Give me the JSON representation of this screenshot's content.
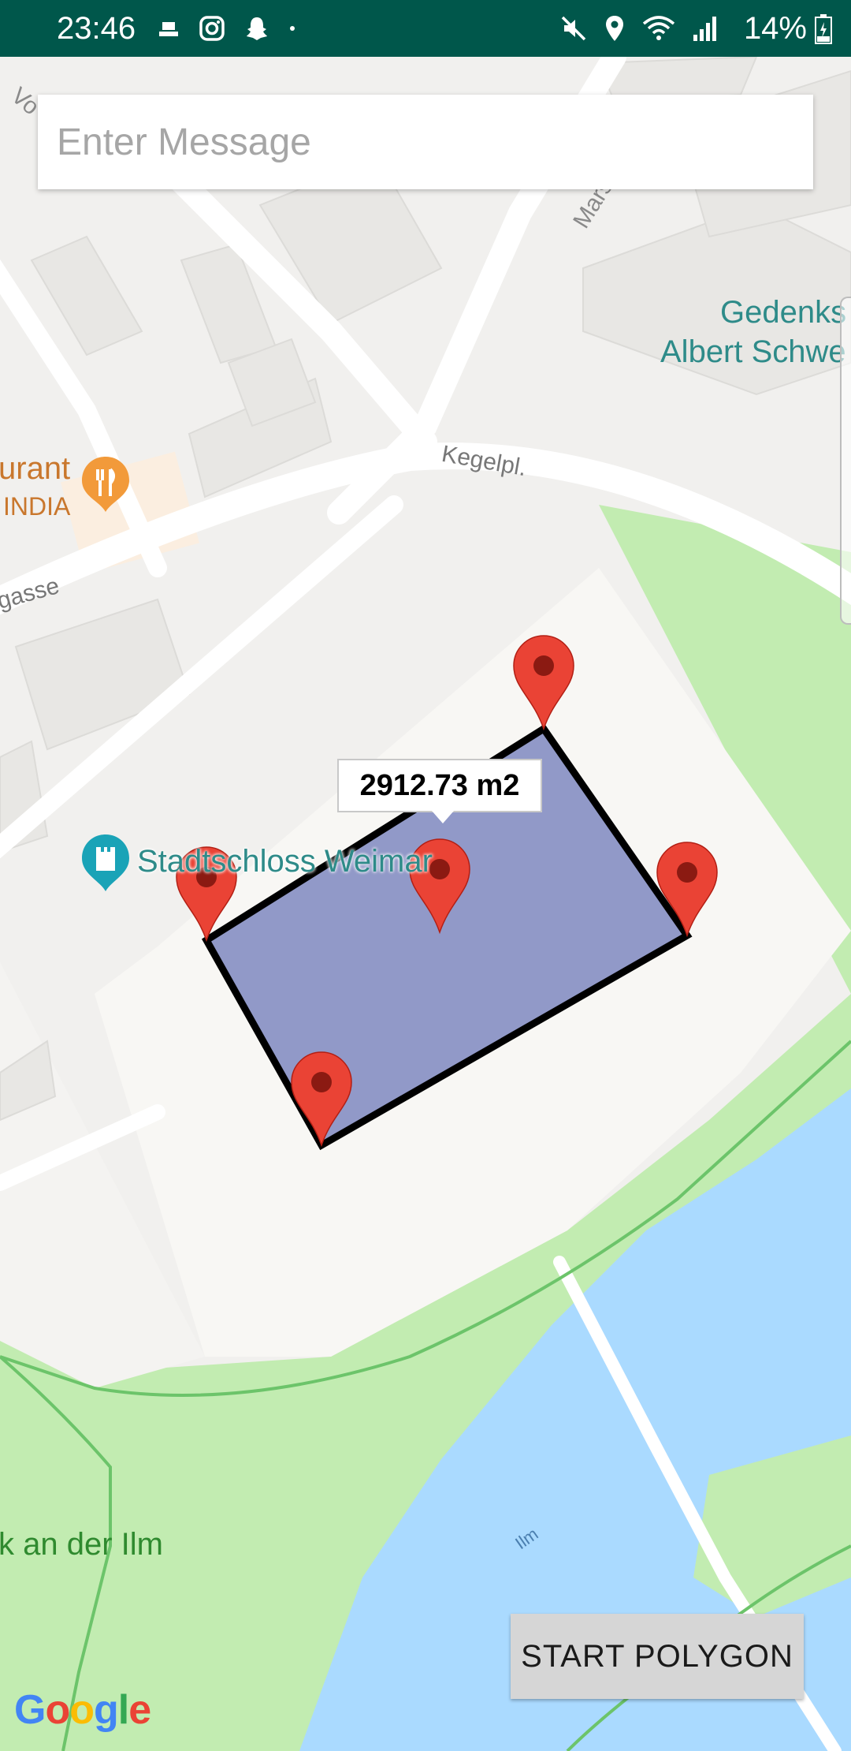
{
  "status_bar": {
    "time": "23:46",
    "battery": "14%",
    "left_icons": [
      "ship-icon",
      "instagram-icon",
      "snapchat-icon",
      "dot-icon"
    ],
    "right_icons": [
      "mute-icon",
      "location-icon",
      "wifi-icon",
      "signal-icon"
    ]
  },
  "search": {
    "placeholder": "Enter Message",
    "value": ""
  },
  "map_labels": {
    "road_top": "Marst",
    "gedenk_line1": "Gedenks",
    "gedenk_line2": "Albert Schwe",
    "restaurant_line1": "urant",
    "restaurant_line2": "INDIA",
    "kegelpl": "Kegelpl.",
    "gasse": "gasse",
    "schloss": "Stadtschloss Weimar",
    "park": "k an der Ilm",
    "river": "Ilm",
    "corner_road": "Vo"
  },
  "polygon": {
    "area_label": "2912.73 m2",
    "fill_color": "#9199c8",
    "stroke_color": "#000000",
    "marker_count": 5
  },
  "buttons": {
    "start_polygon": "START POLYGON"
  },
  "branding": {
    "google": [
      "G",
      "o",
      "o",
      "g",
      "l",
      "e"
    ],
    "google_colors": [
      "#4285F4",
      "#EA4335",
      "#FBBC05",
      "#4285F4",
      "#34A853",
      "#EA4335"
    ]
  },
  "colors": {
    "status_bar": "#00574b",
    "water": "#aadaff",
    "park": "#c0ecae",
    "marker": "#ea4335"
  }
}
